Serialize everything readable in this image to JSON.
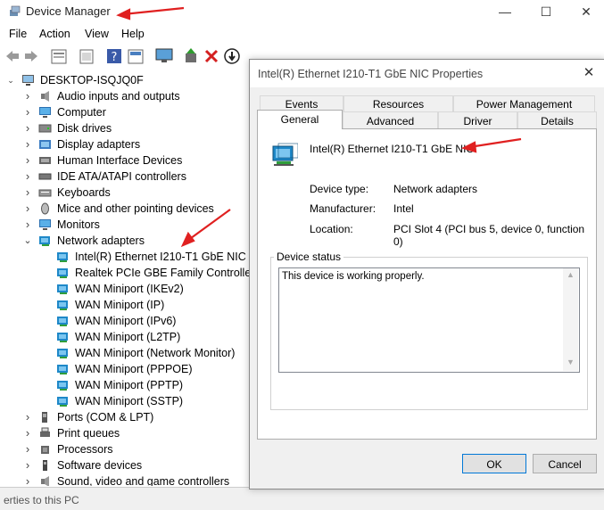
{
  "window": {
    "title": "Device Manager",
    "controls": {
      "minimize": "—",
      "maximize": "☐",
      "close": "✕"
    }
  },
  "menu": [
    "File",
    "Action",
    "View",
    "Help"
  ],
  "tree": {
    "root": "DESKTOP-ISQJQ0F",
    "items": [
      {
        "label": "Audio inputs and outputs",
        "icon": "speaker-icon"
      },
      {
        "label": "Computer",
        "icon": "monitor-icon"
      },
      {
        "label": "Disk drives",
        "icon": "disk-icon"
      },
      {
        "label": "Display adapters",
        "icon": "display-icon"
      },
      {
        "label": "Human Interface Devices",
        "icon": "hid-icon"
      },
      {
        "label": "IDE ATA/ATAPI controllers",
        "icon": "ide-icon"
      },
      {
        "label": "Keyboards",
        "icon": "keyboard-icon"
      },
      {
        "label": "Mice and other pointing devices",
        "icon": "mouse-icon"
      },
      {
        "label": "Monitors",
        "icon": "monitor-icon"
      },
      {
        "label": "Network adapters",
        "icon": "network-icon",
        "expanded": true
      },
      {
        "label": "Intel(R) Ethernet I210-T1 GbE NIC",
        "icon": "network-icon",
        "child": true
      },
      {
        "label": "Realtek PCIe GBE Family Controller",
        "icon": "network-icon",
        "child": true
      },
      {
        "label": "WAN Miniport (IKEv2)",
        "icon": "network-icon",
        "child": true
      },
      {
        "label": "WAN Miniport (IP)",
        "icon": "network-icon",
        "child": true
      },
      {
        "label": "WAN Miniport (IPv6)",
        "icon": "network-icon",
        "child": true
      },
      {
        "label": "WAN Miniport (L2TP)",
        "icon": "network-icon",
        "child": true
      },
      {
        "label": "WAN Miniport (Network Monitor)",
        "icon": "network-icon",
        "child": true
      },
      {
        "label": "WAN Miniport (PPPOE)",
        "icon": "network-icon",
        "child": true
      },
      {
        "label": "WAN Miniport (PPTP)",
        "icon": "network-icon",
        "child": true
      },
      {
        "label": "WAN Miniport (SSTP)",
        "icon": "network-icon",
        "child": true
      },
      {
        "label": "Ports (COM & LPT)",
        "icon": "port-icon"
      },
      {
        "label": "Print queues",
        "icon": "printer-icon"
      },
      {
        "label": "Processors",
        "icon": "cpu-icon"
      },
      {
        "label": "Software devices",
        "icon": "software-icon"
      },
      {
        "label": "Sound, video and game controllers",
        "icon": "speaker-icon"
      }
    ]
  },
  "statusbar": {
    "text": "erties to this PC"
  },
  "dialog": {
    "title": "Intel(R) Ethernet I210-T1 GbE NIC Properties",
    "close": "✕",
    "tabs_top": [
      "Events",
      "Resources",
      "Power Management"
    ],
    "tabs_bottom": [
      "General",
      "Advanced",
      "Driver",
      "Details"
    ],
    "device_name": "Intel(R) Ethernet I210-T1 GbE NIC",
    "properties": [
      {
        "label": "Device type:",
        "value": "Network adapters"
      },
      {
        "label": "Manufacturer:",
        "value": "Intel"
      },
      {
        "label": "Location:",
        "value": "PCI Slot 4 (PCI bus 5, device 0, function 0)"
      }
    ],
    "device_status_label": "Device status",
    "device_status_text": "This device is working properly.",
    "ok": "OK",
    "cancel": "Cancel"
  },
  "colors": {
    "accent": "#0078d7",
    "annotation_arrow": "#e02020",
    "network_icon": "#1e88c8"
  }
}
